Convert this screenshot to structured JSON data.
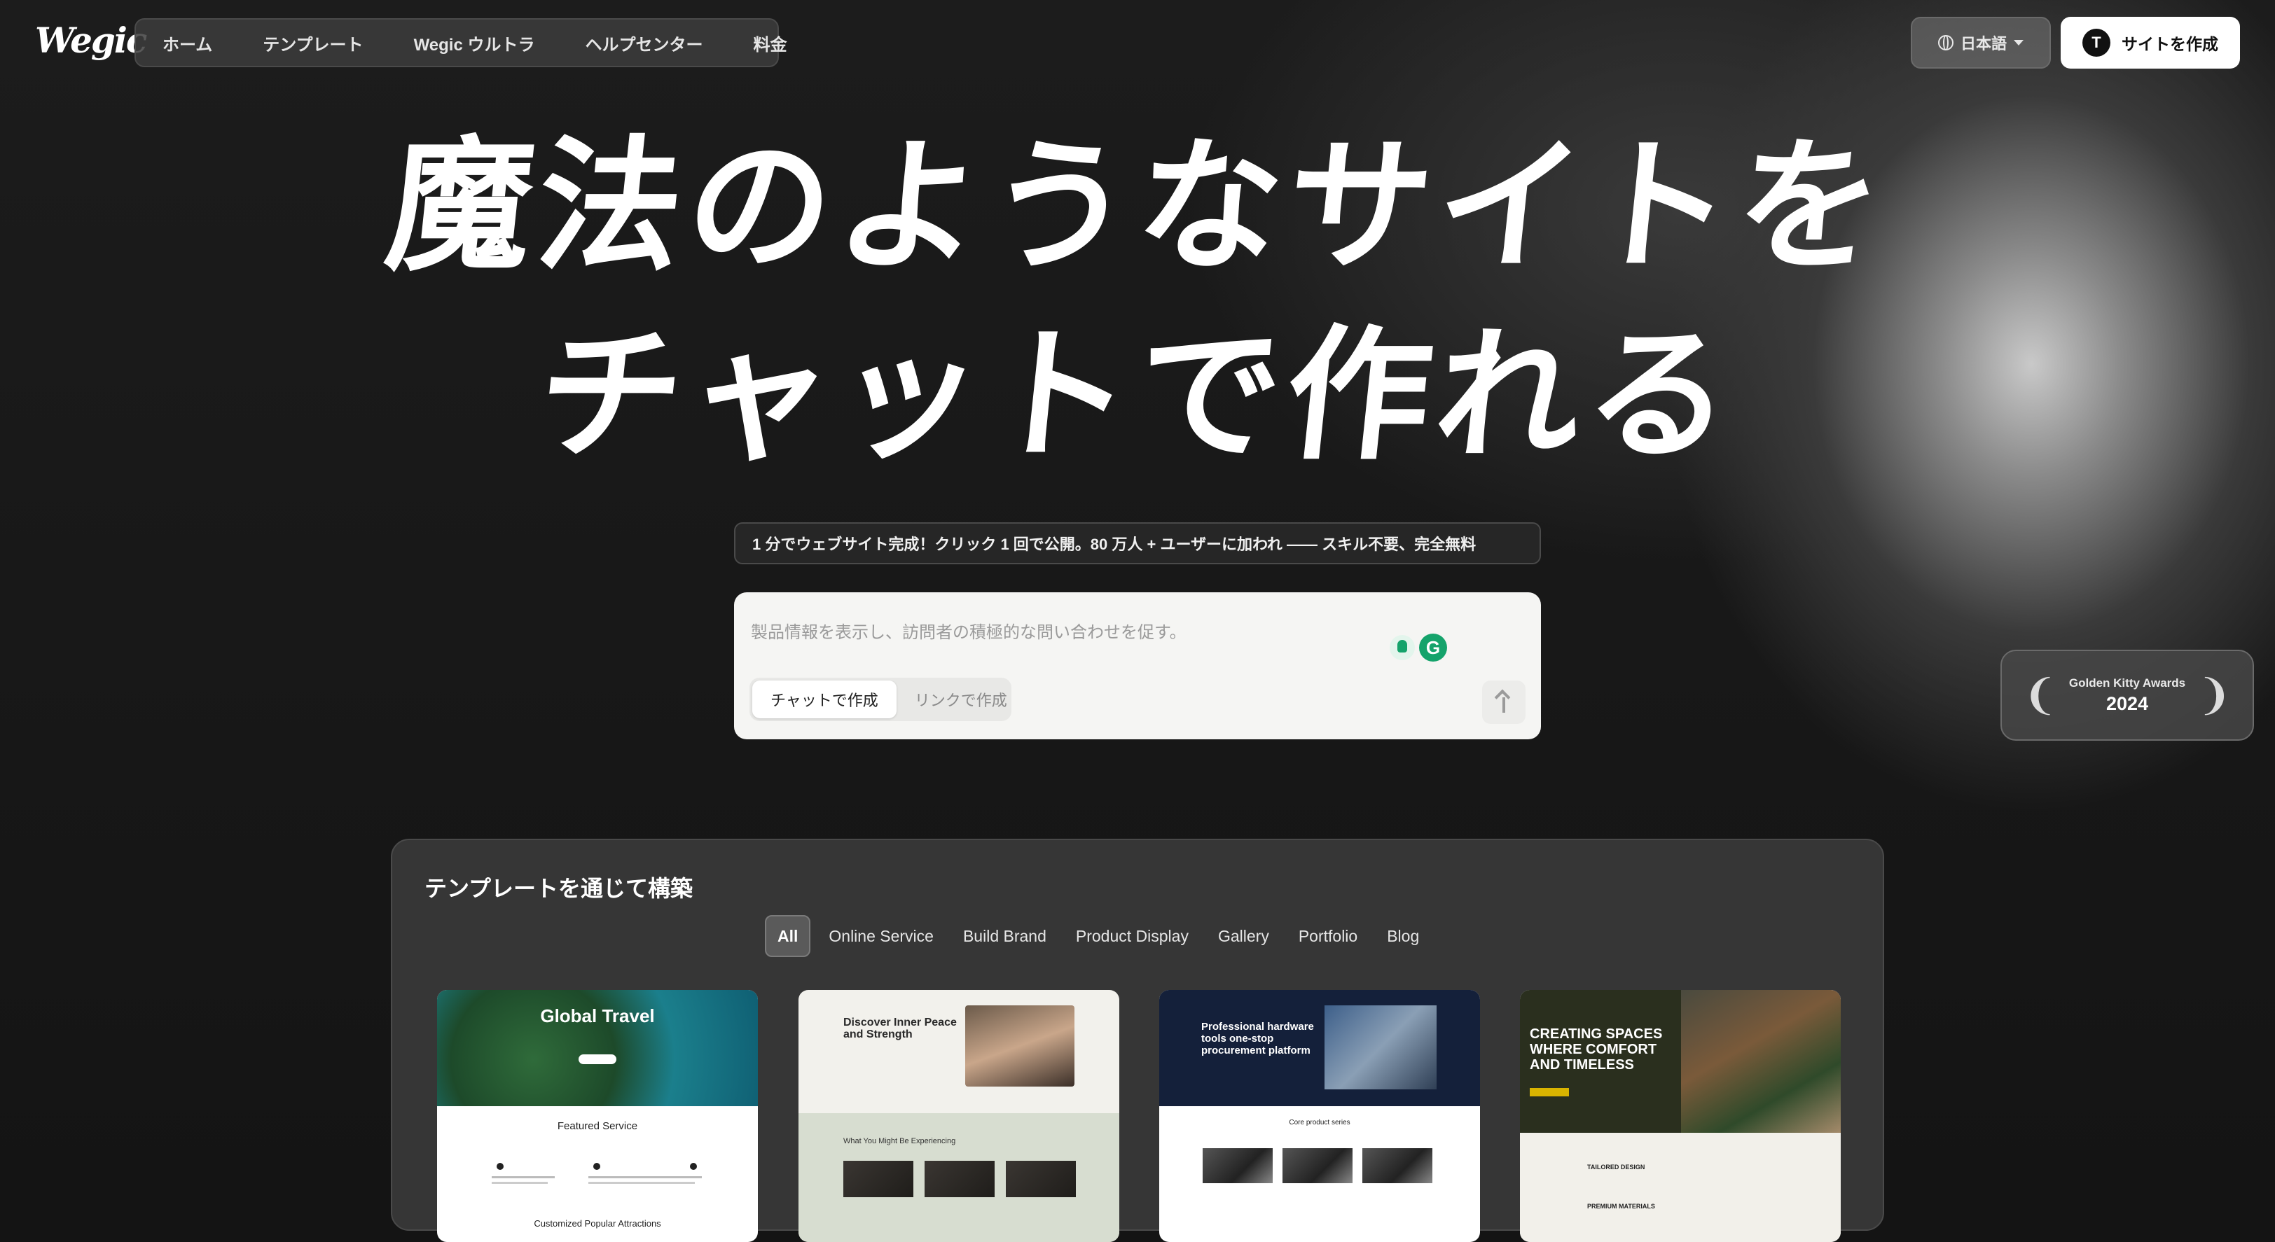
{
  "header": {
    "logo": "Wegic",
    "nav": [
      "ホーム",
      "テンプレート",
      "Wegic ウルトラ",
      "ヘルプセンター",
      "料金"
    ],
    "language": "日本語",
    "create_site": {
      "badge": "T",
      "label": "サイトを作成"
    }
  },
  "hero": {
    "line1": "魔法のようなサイトを",
    "line2": "チャットで作れる",
    "tagline": "1 分でウェブサイト完成！クリック 1 回で公開。80 万人 + ユーザーに加われ —— スキル不要、完全無料"
  },
  "chat": {
    "placeholder": "製品情報を表示し、訪問者の積極的な問い合わせを促す。",
    "mode_chat": "チャットで作成",
    "mode_link": "リンクで作成"
  },
  "award": {
    "name": "Golden Kitty Awards",
    "year": "2024"
  },
  "templates": {
    "title": "テンプレートを通じて構築",
    "categories": [
      "All",
      "Online Service",
      "Build Brand",
      "Product Display",
      "Gallery",
      "Portfolio",
      "Blog"
    ],
    "cards": [
      {
        "title": "Global Travel",
        "section": "Featured Service",
        "section2": "Customized Popular Attractions"
      },
      {
        "title": "Discover Inner Peace and Strength",
        "sub": "What You Might Be Experiencing"
      },
      {
        "title": "Professional hardware tools one-stop procurement platform",
        "sub": "Core product series"
      },
      {
        "title": "CREATING SPACES WHERE COMFORT AND TIMELESS",
        "t1": "TAILORED DESIGN",
        "t2": "PREMIUM MATERIALS"
      }
    ]
  },
  "colors": {
    "background": "#141414",
    "accent_green": "#15a36b",
    "award_yellow": "#d9b400"
  }
}
